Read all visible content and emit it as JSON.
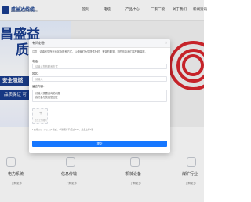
{
  "header": {
    "logo_text": "盛益达线缆",
    "logo_sub": "SHENGYIDA CABLE CO.,LTD",
    "nav": [
      "首页",
      "电缆",
      "产品中心",
      "厂家厂貌",
      "关于我们",
      "新闻资讯"
    ]
  },
  "hero": {
    "title_line1": "昌盛益",
    "title_line2": "质",
    "safety_text": "安全阻燃",
    "bottom_text": "品质保证 可"
  },
  "features": [
    {
      "label": "电力系统",
      "more": "了解更多",
      "icon": "power-icon"
    },
    {
      "label": "信息传输",
      "more": "了解更多",
      "icon": "signal-icon"
    },
    {
      "label": "机械设备",
      "more": "了解更多",
      "icon": "machine-icon"
    },
    {
      "label": "煤矿行业",
      "more": "了解更多",
      "icon": "mining-icon"
    }
  ],
  "modal": {
    "title": "有问必答",
    "close_icon": "close-icon",
    "notice": "注意：请填写您所在地区及联系方式，以便我们为您提供及时、有效的服务。您的信息我们将严格保密。",
    "fields": [
      {
        "label": "电话：",
        "placeholder": "请输入您的联系方式"
      },
      {
        "label": "姓名：",
        "placeholder": "请输入"
      },
      {
        "label": "留言内容：",
        "value": "请输入需要咨询的问题\n我们会尽快给您回复"
      }
    ],
    "upload_plus": "+",
    "upload_text": "点击上传图片",
    "hint": "* 支持 jpg、png、gif 格式，单张图片不超过2MB，最多上传3张",
    "submit_label": "提交"
  },
  "colors": {
    "brand": "#1a3d8f",
    "cable_red": "#d7262d",
    "submit_blue": "#1677ff"
  }
}
